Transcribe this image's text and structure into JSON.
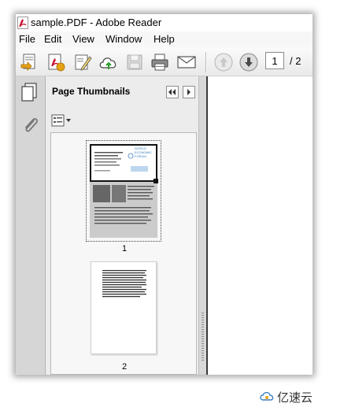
{
  "window": {
    "title": "sample.PDF - Adobe Reader"
  },
  "menu": {
    "items": [
      "File",
      "Edit",
      "View",
      "Window",
      "Help"
    ]
  },
  "toolbar": {
    "buttons": [
      "open-icon",
      "create-pdf-icon",
      "sign-icon",
      "upload-icon",
      "save-icon",
      "print-icon",
      "email-icon",
      "previous-page-icon",
      "next-page-icon"
    ],
    "current_page": "1",
    "page_total": "/ 2"
  },
  "sidebar": {
    "rail_icons": [
      "page-thumbnails-icon",
      "attachment-icon"
    ],
    "panel_title": "Page Thumbnails",
    "options_icon": "thumbnail-options-icon"
  },
  "thumbnails": [
    {
      "page_label": "1",
      "selected": true
    },
    {
      "page_label": "2",
      "selected": false
    }
  ],
  "page1_logo": [
    "WORLD",
    "ECONOMIC",
    "FORUM"
  ],
  "watermark": {
    "text": "亿速云"
  },
  "colors": {
    "acrobat_red": "#c8102e",
    "panel_bg": "#ececec",
    "rail_bg": "#d6d6d6",
    "logo_blue": "#3a7fc1"
  }
}
